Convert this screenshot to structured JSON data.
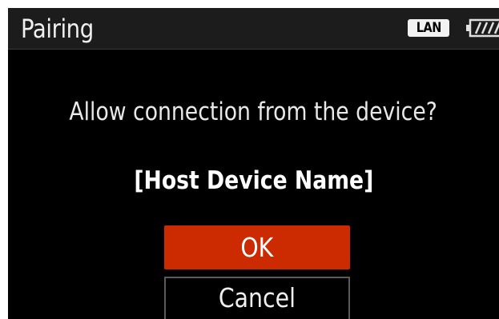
{
  "header": {
    "title": "Pairing",
    "lan_badge": "LAN",
    "battery_icon": "battery-icon"
  },
  "dialog": {
    "message": "Allow connection from the device?",
    "device_name": "[Host Device Name]",
    "ok_label": "OK",
    "cancel_label": "Cancel"
  },
  "colors": {
    "background": "#000000",
    "title_bar": "#1c1c1c",
    "accent": "#cc2a00",
    "text": "#ffffff"
  }
}
